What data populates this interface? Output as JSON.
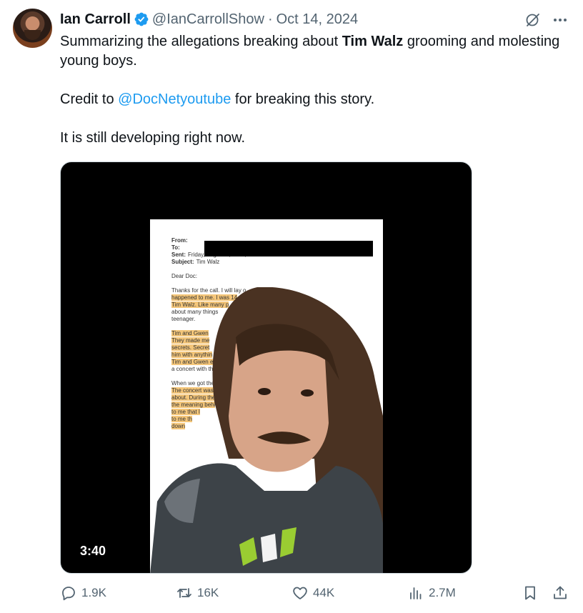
{
  "author": {
    "name": "Ian Carroll",
    "handle": "@IanCarrollShow",
    "separator": "·",
    "date": "Oct 14, 2024"
  },
  "tweet": {
    "line1_pre": "Summarizing the allegations breaking about ",
    "line1_bold": "Tim Walz",
    "line1_post": " grooming and molesting young boys.",
    "line2_pre": "Credit to ",
    "line2_mention": "@DocNetyoutube",
    "line2_post": " for breaking this story.",
    "line3": "It is still developing right now."
  },
  "media": {
    "duration": "3:40",
    "document": {
      "from_label": "From:",
      "to_label": "To:",
      "sent_label": "Sent:",
      "sent_value": "Friday, August 9, 2024, at 04:12:54 PM EDT",
      "subject_label": "Subject:",
      "subject_value": "Tim Walz",
      "greeting": "Dear Doc:",
      "para1": [
        "Thanks for the call. I will lay o",
        "happened to me. I was 14",
        "Tim Walz. Like many p",
        "about many things",
        "teenager."
      ],
      "para2": [
        "Tim and Gwen",
        "They made me",
        "secrets. Secret",
        "him with anythin",
        "Tim and Gwen e",
        "a concert with th"
      ],
      "para3": [
        "When we got the",
        "The concert was",
        "about. During the",
        "the meaning behi",
        "to me that I",
        "to me th",
        "down"
      ]
    }
  },
  "actions": {
    "replies": "1.9K",
    "reposts": "16K",
    "likes": "44K",
    "views": "2.7M"
  },
  "colors": {
    "accent": "#1d9bf0",
    "muted": "#536471",
    "text": "#0f1419",
    "highlight": "#f4c67a"
  },
  "icons": [
    "verified-badge-icon",
    "grok-icon",
    "more-icon",
    "reply-icon",
    "repost-icon",
    "like-icon",
    "views-icon",
    "bookmark-icon",
    "share-icon"
  ]
}
